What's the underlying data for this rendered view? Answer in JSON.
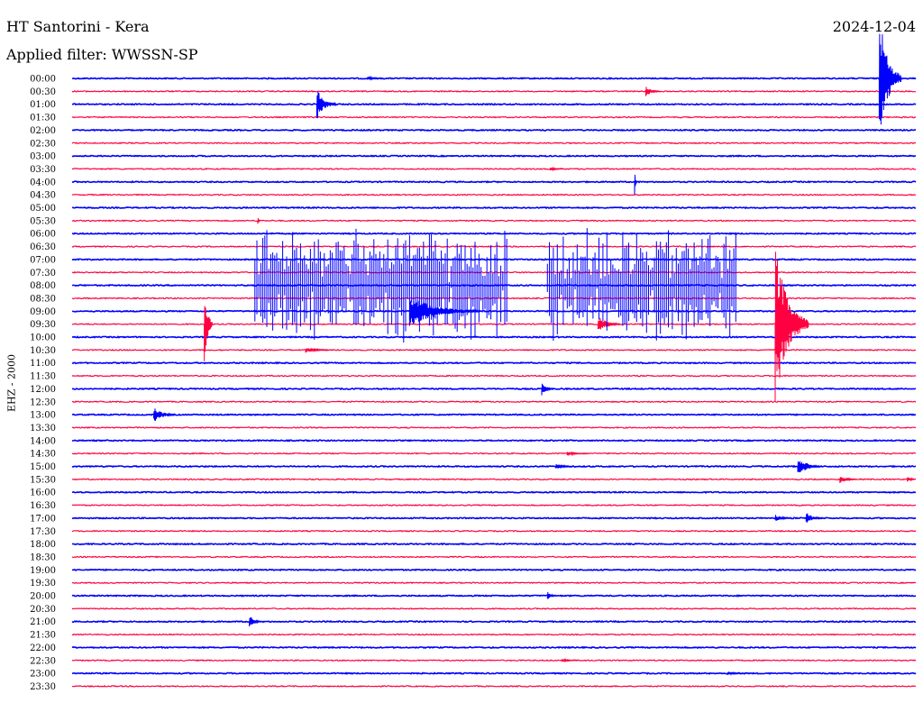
{
  "header": {
    "title": "HT Santorini - Kera",
    "date": "2024-12-04",
    "filter": "Applied filter: WWSSN-SP",
    "channel": "EHZ - 2000"
  },
  "colors": {
    "a": "#0000ff",
    "b": "#ff0040",
    "text": "#000000"
  },
  "chart_data": {
    "type": "line",
    "title": "HT Santorini - Kera",
    "ylabel": "EHZ - 2000",
    "time_span_minutes": 30,
    "trace_labels": [
      "00:00",
      "00:30",
      "01:00",
      "01:30",
      "02:00",
      "02:30",
      "03:00",
      "03:30",
      "04:00",
      "04:30",
      "05:00",
      "05:30",
      "06:00",
      "06:30",
      "07:00",
      "07:30",
      "08:00",
      "08:30",
      "09:00",
      "09:30",
      "10:00",
      "10:30",
      "11:00",
      "11:30",
      "12:00",
      "12:30",
      "13:00",
      "13:30",
      "14:00",
      "14:30",
      "15:00",
      "15:30",
      "16:00",
      "16:30",
      "17:00",
      "17:30",
      "18:00",
      "18:30",
      "19:00",
      "19:30",
      "20:00",
      "20:30",
      "21:00",
      "21:30",
      "22:00",
      "22:30",
      "23:00",
      "23:30"
    ],
    "trace_colors_alternating": [
      "#0000ff",
      "#ff0040"
    ],
    "events": [
      {
        "trace": "00:00",
        "minute": 10.5,
        "amplitude": 2,
        "duration_min": 0.6
      },
      {
        "trace": "00:00",
        "minute": 28.7,
        "amplitude": 75,
        "duration_min": 0.8
      },
      {
        "trace": "00:30",
        "minute": 20.4,
        "amplitude": 6,
        "duration_min": 0.5
      },
      {
        "trace": "01:00",
        "minute": 8.7,
        "amplitude": 18,
        "duration_min": 0.7
      },
      {
        "trace": "03:30",
        "minute": 17.0,
        "amplitude": 2,
        "duration_min": 0.5
      },
      {
        "trace": "04:00",
        "minute": 20.0,
        "amplitude": 16,
        "duration_min": 0.1
      },
      {
        "trace": "05:30",
        "minute": 6.6,
        "amplitude": 5,
        "duration_min": 0.1
      },
      {
        "trace": "09:00",
        "minute": 12.0,
        "amplitude": 18,
        "duration_min": 2.5
      },
      {
        "trace": "09:30",
        "minute": 4.7,
        "amplitude": 48,
        "duration_min": 0.3
      },
      {
        "trace": "09:30",
        "minute": 18.7,
        "amplitude": 10,
        "duration_min": 0.8
      },
      {
        "trace": "09:30",
        "minute": 25.0,
        "amplitude": 90,
        "duration_min": 1.2
      },
      {
        "trace": "10:30",
        "minute": 8.3,
        "amplitude": 3,
        "duration_min": 1.0
      },
      {
        "trace": "12:00",
        "minute": 16.7,
        "amplitude": 9,
        "duration_min": 0.4
      },
      {
        "trace": "13:00",
        "minute": 2.9,
        "amplitude": 9,
        "duration_min": 0.8
      },
      {
        "trace": "14:30",
        "minute": 17.6,
        "amplitude": 3,
        "duration_min": 0.6
      },
      {
        "trace": "15:00",
        "minute": 17.2,
        "amplitude": 4,
        "duration_min": 0.6
      },
      {
        "trace": "15:00",
        "minute": 25.8,
        "amplitude": 12,
        "duration_min": 0.8
      },
      {
        "trace": "15:30",
        "minute": 27.3,
        "amplitude": 5,
        "duration_min": 0.6
      },
      {
        "trace": "15:30",
        "minute": 29.7,
        "amplitude": 4,
        "duration_min": 0.3
      },
      {
        "trace": "17:00",
        "minute": 25.0,
        "amplitude": 4,
        "duration_min": 0.6
      },
      {
        "trace": "17:00",
        "minute": 26.1,
        "amplitude": 7,
        "duration_min": 0.6
      },
      {
        "trace": "20:00",
        "minute": 16.9,
        "amplitude": 6,
        "duration_min": 0.3
      },
      {
        "trace": "21:00",
        "minute": 6.3,
        "amplitude": 8,
        "duration_min": 0.4
      },
      {
        "trace": "22:30",
        "minute": 17.4,
        "amplitude": 2,
        "duration_min": 0.6
      },
      {
        "trace": "23:00",
        "minute": 23.3,
        "amplitude": 2,
        "duration_min": 0.8
      }
    ],
    "swarm_intervals": [
      {
        "trace": "06:30",
        "from_minute": 6.5,
        "to_minute": 15.5
      },
      {
        "trace": "06:30",
        "from_minute": 16.9,
        "to_minute": 23.6
      }
    ]
  }
}
